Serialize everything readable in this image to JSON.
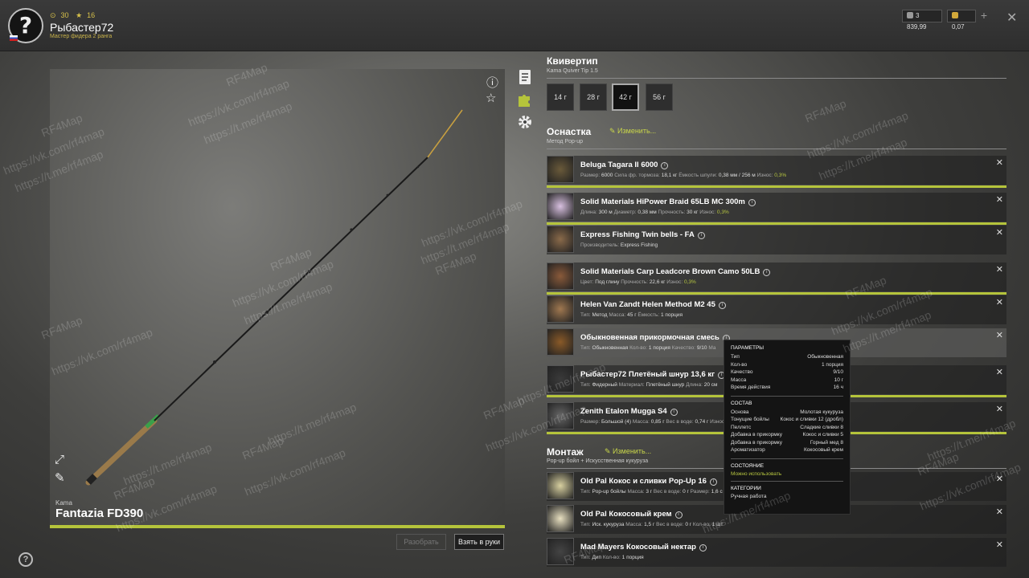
{
  "player": {
    "level": "30",
    "stars": "16",
    "name": "Рыбастер72",
    "rank": "Мастер фидера 2 ранга"
  },
  "currency": {
    "silver": "3 839,99",
    "gold": "0,07"
  },
  "rod": {
    "brand": "Kama",
    "name": "Fantazia FD390",
    "btn_disassemble": "Разобрать",
    "btn_take": "Взять в руки"
  },
  "quiver": {
    "title": "Квивертип",
    "subtitle": "Kama Quiver Tip 1.5",
    "tips": [
      "14 г",
      "28 г",
      "42 г",
      "56 г"
    ],
    "selected": "42 г"
  },
  "tackle": {
    "title": "Оснастка",
    "edit": "Изменить...",
    "subtitle": "Метод Pop-up",
    "items": [
      {
        "name": "Beluga Tagara II 6000",
        "desc": [
          [
            "Размер:",
            "6000"
          ],
          [
            "Сила фр. тормоза:",
            "18,1 кг"
          ],
          [
            "Ёмкость шпули:",
            "0,38 мм / 256 м"
          ],
          [
            "Износ:",
            "0,3%"
          ]
        ]
      },
      {
        "name": "Solid Materials HiPower Braid 65LB MC 300m",
        "desc": [
          [
            "Длина:",
            "300 м"
          ],
          [
            "Диаметр:",
            "0,38 мм"
          ],
          [
            "Прочность:",
            "30 кг"
          ],
          [
            "Износ:",
            "0,3%"
          ]
        ]
      },
      {
        "name": "Express Fishing Twin bells - FA",
        "desc": [
          [
            "Производитель:",
            "Express Fishing"
          ]
        ]
      },
      {
        "name": "Solid Materials Carp Leadcore Brown Camo 50LB",
        "desc": [
          [
            "Цвет:",
            "Под глину"
          ],
          [
            "Прочность:",
            "22,6 кг"
          ],
          [
            "Износ:",
            "0,3%"
          ]
        ]
      },
      {
        "name": "Helen Van Zandt Helen Method M2 45",
        "desc": [
          [
            "Тип:",
            "Метод"
          ],
          [
            "Масса:",
            "45 г"
          ],
          [
            "Ёмкость:",
            "1 порция"
          ]
        ]
      },
      {
        "name": "Обыкновенная прикормочная смесь",
        "desc": [
          [
            "Тип:",
            "Обыкновенная"
          ],
          [
            "Кол-во:",
            "1 порция"
          ],
          [
            "Качество:",
            "9/10"
          ],
          [
            "Ма",
            ""
          ]
        ]
      },
      {
        "name": "Рыбастер72 Плетёный шнур 13,6 кг",
        "desc": [
          [
            "Тип:",
            "Фидерный"
          ],
          [
            "Материал:",
            "Плетёный шнур"
          ],
          [
            "Длина:",
            "20 см"
          ]
        ]
      },
      {
        "name": "Zenith Etalon Mugga S4",
        "desc": [
          [
            "Размер:",
            "Большой (4)"
          ],
          [
            "Масса:",
            "0,85 г"
          ],
          [
            "Вес в воде:",
            "0,74 г"
          ],
          [
            "Износ:",
            ""
          ]
        ]
      }
    ]
  },
  "mount": {
    "title": "Монтаж",
    "edit": "Изменить...",
    "subtitle": "Pop-up бойл + Искусственная кукуруза",
    "items": [
      {
        "name": "Old Pal Кокос и сливки Pop-Up 16",
        "desc": [
          [
            "Тип:",
            "Pop-up бойлы"
          ],
          [
            "Масса:",
            "3 г"
          ],
          [
            "Вес в воде:",
            "0 г"
          ],
          [
            "Размер:",
            "1,6 с"
          ]
        ]
      },
      {
        "name": "Old Pal Кокосовый крем",
        "desc": [
          [
            "Тип:",
            "Иск. кукуруза"
          ],
          [
            "Масса:",
            "1,5 г"
          ],
          [
            "Вес в воде:",
            "0 г"
          ],
          [
            "Кол-во:",
            "1 шт"
          ]
        ]
      },
      {
        "name": "Mad Mayers Кокосовый нектар",
        "desc": [
          [
            "Тип:",
            "Дип"
          ],
          [
            "Кол-во:",
            "1 порция"
          ]
        ]
      }
    ]
  },
  "popup": {
    "params_title": "ПАРАМЕТРЫ",
    "params": [
      [
        "Тип",
        "Обыкновенная"
      ],
      [
        "Кол-во",
        "1 порция"
      ],
      [
        "Качество",
        "9/10"
      ],
      [
        "Масса",
        "10 г"
      ],
      [
        "Время действия",
        "16 ч"
      ]
    ],
    "comp_title": "СОСТАВ",
    "comp": [
      [
        "Основа",
        "Молотая кукуруза"
      ],
      [
        "Тонущие бойлы",
        "Кокос и сливки 12 (дробл)"
      ],
      [
        "Пеллетс",
        "Сладкие сливки 8"
      ],
      [
        "Добавка в прикормку",
        "Кокос и сливки 5"
      ],
      [
        "Добавка в прикормку",
        "Горный мед 8"
      ],
      [
        "Ароматизатор",
        "Кокосовый крем"
      ]
    ],
    "state_title": "СОСТОЯНИЕ",
    "state": "Можно использовать",
    "cat_title": "КАТЕГОРИИ",
    "cat": "Ручная работа"
  },
  "watermark": [
    "RF4Map",
    "https://vk.com/rf4map",
    "https://t.me/rf4map"
  ],
  "colors": {
    "accent": "#b5c43b",
    "gold": "#d6c04a"
  }
}
